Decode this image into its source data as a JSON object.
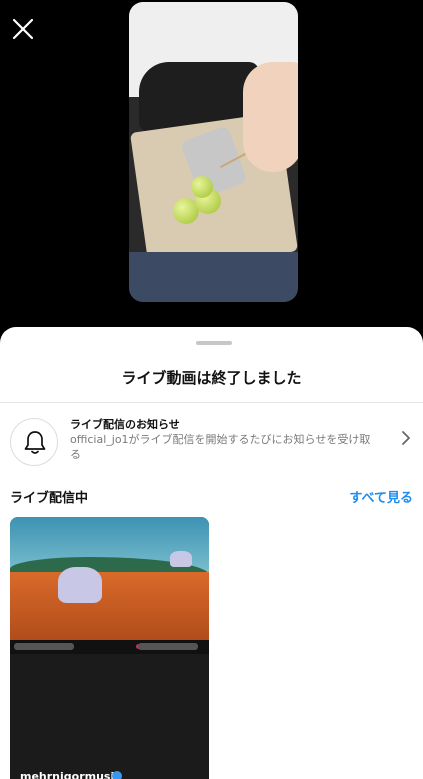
{
  "sheet": {
    "title": "ライブ動画は終了しました"
  },
  "notification": {
    "title": "ライブ配信のお知らせ",
    "description": "official_jo1がライブ配信を開始するたびにお知らせを受け取る"
  },
  "live_section": {
    "label": "ライブ配信中",
    "see_all": "すべて見る",
    "cards": [
      {
        "username": "mehrnigormusic",
        "verified": true
      }
    ]
  },
  "colors": {
    "accent": "#1d8cf0",
    "background": "#000000",
    "sheet": "#ffffff"
  },
  "icons": [
    "close-icon",
    "bell-icon",
    "chevron-right-icon",
    "verified-icon"
  ]
}
